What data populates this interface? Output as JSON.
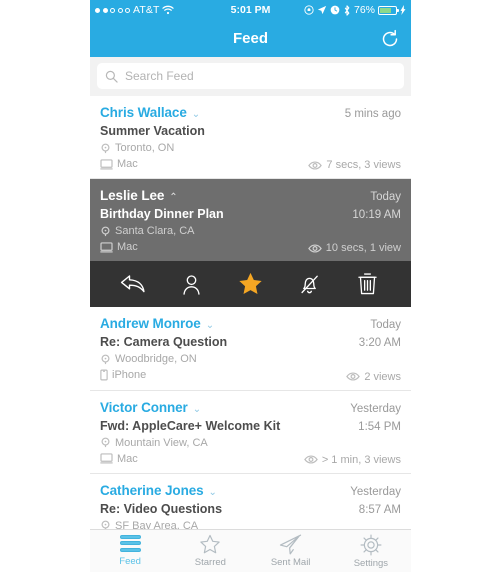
{
  "status_bar": {
    "signal_dots_filled": 2,
    "signal_dots_total": 5,
    "carrier": "AT&T",
    "wifi_icon": "wifi-icon",
    "time": "5:01 PM",
    "rotation_lock_icon": "rotation-lock-icon",
    "location_icon": "location-arrow-icon",
    "alarm_icon": "alarm-clock-icon",
    "bluetooth_icon": "bluetooth-icon",
    "battery_percent": "76%",
    "battery_icon": "battery-charging-icon"
  },
  "navbar": {
    "title": "Feed",
    "refresh_icon": "refresh-icon"
  },
  "search": {
    "icon": "search-icon",
    "placeholder": "Search Feed",
    "value": ""
  },
  "feed": {
    "items": [
      {
        "sender": "Chris Wallace",
        "chevron": "⌄",
        "chevron_icon": "chevron-down-icon",
        "time_top": "5 mins ago",
        "time_bottom": "",
        "subject": "Summer Vacation",
        "location_icon": "location-pin-icon",
        "location": "Toronto, ON",
        "device_icon": "desktop-icon",
        "device": "Mac",
        "views_icon": "eye-icon",
        "views": "7 secs, 3 views",
        "selected": false
      },
      {
        "sender": "Leslie Lee",
        "chevron": "⌃",
        "chevron_icon": "chevron-up-icon",
        "time_top": "Today",
        "time_bottom": "10:19 AM",
        "subject": "Birthday Dinner Plan",
        "location_icon": "location-pin-icon",
        "location": "Santa Clara, CA",
        "device_icon": "desktop-icon",
        "device": "Mac",
        "views_icon": "eye-icon",
        "views": "10 secs, 1 view",
        "selected": true
      },
      {
        "sender": "Andrew Monroe",
        "chevron": "⌄",
        "chevron_icon": "chevron-down-icon",
        "time_top": "Today",
        "time_bottom": "3:20 AM",
        "subject": "Re: Camera Question",
        "location_icon": "location-pin-icon",
        "location": "Woodbridge, ON",
        "device_icon": "phone-icon",
        "device": "iPhone",
        "views_icon": "eye-icon",
        "views": "2 views",
        "selected": false
      },
      {
        "sender": "Victor Conner",
        "chevron": "⌄",
        "chevron_icon": "chevron-down-icon",
        "time_top": "Yesterday",
        "time_bottom": "1:54 PM",
        "subject": "Fwd: AppleCare+ Welcome Kit",
        "location_icon": "location-pin-icon",
        "location": "Mountain View, CA",
        "device_icon": "desktop-icon",
        "device": "Mac",
        "views_icon": "eye-icon",
        "views": "> 1 min, 3 views",
        "selected": false
      },
      {
        "sender": "Catherine Jones",
        "chevron": "⌄",
        "chevron_icon": "chevron-down-icon",
        "time_top": "Yesterday",
        "time_bottom": "8:57 AM",
        "subject": "Re: Video Questions",
        "location_icon": "location-pin-icon",
        "location": "SF Bay Area, CA",
        "device_icon": "",
        "device": "",
        "views_icon": "",
        "views": "",
        "selected": false
      }
    ]
  },
  "action_bar": {
    "actions": [
      {
        "name": "reply-icon",
        "label": "Reply"
      },
      {
        "name": "contact-icon",
        "label": "Contact"
      },
      {
        "name": "star-icon",
        "label": "Star"
      },
      {
        "name": "mute-bell-icon",
        "label": "Mute"
      },
      {
        "name": "trash-icon",
        "label": "Delete"
      }
    ],
    "star_active_color": "#f5a623"
  },
  "tabbar": {
    "tabs": [
      {
        "label": "Feed",
        "icon": "feed-lines-icon",
        "active": true
      },
      {
        "label": "Starred",
        "icon": "star-outline-icon",
        "active": false
      },
      {
        "label": "Sent Mail",
        "icon": "paper-plane-icon",
        "active": false
      },
      {
        "label": "Settings",
        "icon": "gear-icon",
        "active": false
      }
    ]
  },
  "colors": {
    "accent": "#29abe2",
    "tab_active": "#5bc2e7",
    "selected_row": "#6e6e6e",
    "action_bar": "#333333",
    "star": "#f5a623"
  }
}
